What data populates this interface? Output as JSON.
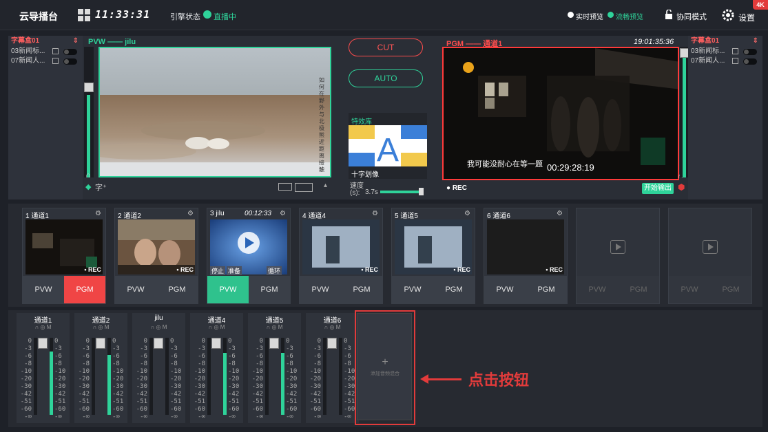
{
  "topbar": {
    "title": "云导播台",
    "clock": "11:33:31",
    "stream_label": "引擎状态",
    "stream_status": "直播中",
    "preview_realtime": "实时预览",
    "preview_smooth": "流畅预览",
    "collab": "协同模式",
    "settings": "设置",
    "badge": "4K"
  },
  "left_panel": {
    "title": "字幕盒01",
    "items": [
      "03新闻标...",
      "07新闻人..."
    ]
  },
  "right_panel": {
    "title": "字幕盒01",
    "items": [
      "03新闻标...",
      "07新闻人..."
    ]
  },
  "pvw": {
    "header": "PVW —— jilu",
    "overlay_text": "如何在野外与北极熊近距离接触"
  },
  "pgm": {
    "header": "PGM —— 通道1",
    "time": "19:01:35:36",
    "subtitle": "我可能没耐心在等一题",
    "timecode": "00:29:28:19",
    "rec": "● REC",
    "start_output": "开始输出"
  },
  "controls": {
    "cut": "CUT",
    "auto": "AUTO",
    "fx_title": "特效库",
    "fx_name": "十字划像",
    "speed_label": "速度\n(s):",
    "speed_value": "3.7s",
    "speed_fraction": 0.9
  },
  "channels": [
    {
      "head": "1 通道1",
      "pvw": "PVW",
      "pgm": "PGM",
      "rec": "• REC",
      "state": "pgm"
    },
    {
      "head": "2 通道2",
      "pvw": "PVW",
      "pgm": "PGM",
      "rec": "• REC",
      "state": ""
    },
    {
      "head": "3 jilu",
      "time": "00:12:33",
      "pvw": "PVW",
      "pgm": "PGM",
      "stop": "停止",
      "ready": "准备",
      "loop": "循环",
      "state": "pvw"
    },
    {
      "head": "4 通道4",
      "pvw": "PVW",
      "pgm": "PGM",
      "rec": "• REC",
      "state": ""
    },
    {
      "head": "5 通道5",
      "pvw": "PVW",
      "pgm": "PGM",
      "rec": "• REC",
      "state": ""
    },
    {
      "head": "6 通道6",
      "pvw": "PVW",
      "pgm": "PGM",
      "rec": "• REC",
      "state": ""
    },
    {
      "head": "",
      "pvw": "PVW",
      "pgm": "PGM",
      "state": "empty"
    },
    {
      "head": "",
      "pvw": "PVW",
      "pgm": "PGM",
      "state": "empty"
    }
  ],
  "mixer": {
    "strips": [
      {
        "name": "通道1",
        "level": 0.82
      },
      {
        "name": "通道2",
        "level": 0.78
      },
      {
        "name": "jilu",
        "level": 0.0
      },
      {
        "name": "通道4",
        "level": 0.8
      },
      {
        "name": "通道5",
        "level": 0.8
      },
      {
        "name": "通道6",
        "level": 0.0
      }
    ],
    "scale": [
      "0",
      "-3",
      "-6",
      "-8",
      "-10",
      "-20",
      "-30",
      "-42",
      "-51",
      "-60",
      "-∞"
    ],
    "icons": "∩ ◎ M",
    "add_label": "添加音频混合",
    "annotation": "点击按钮"
  },
  "colors": {
    "accent": "#2fd39a",
    "alert": "#e23b3b",
    "background": "#1e2128"
  }
}
